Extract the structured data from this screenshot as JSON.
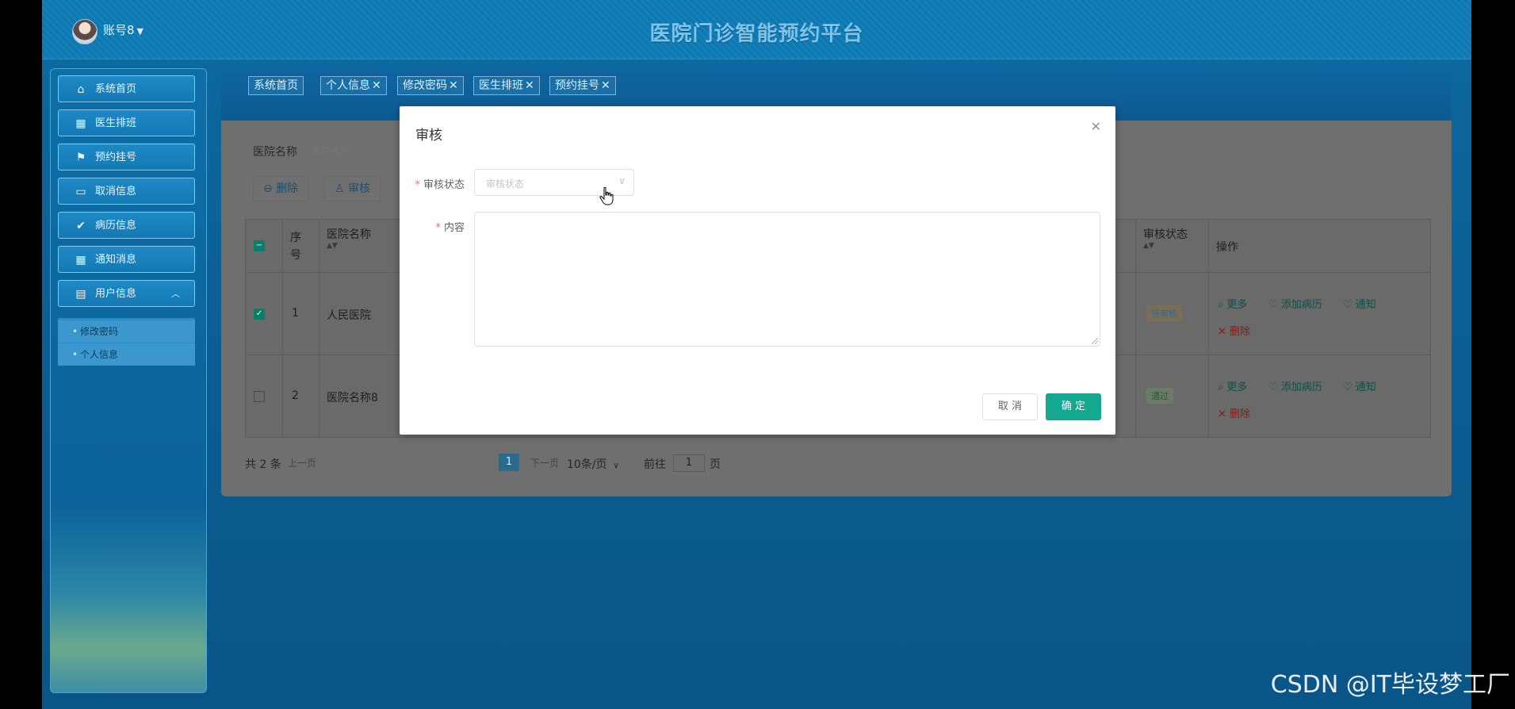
{
  "header": {
    "account": "账号8",
    "app_title": "医院门诊智能预约平台"
  },
  "sidebar": {
    "items": [
      {
        "label": "系统首页",
        "icon": "home-icon"
      },
      {
        "label": "医生排班",
        "icon": "grid-icon"
      },
      {
        "label": "预约挂号",
        "icon": "flag-icon"
      },
      {
        "label": "取消信息",
        "icon": "monitor-icon"
      },
      {
        "label": "病历信息",
        "icon": "clipboard-icon"
      },
      {
        "label": "通知消息",
        "icon": "grid-icon"
      },
      {
        "label": "用户信息",
        "icon": "card-icon",
        "expanded": true
      }
    ],
    "submenu": [
      "修改密码",
      "个人信息"
    ]
  },
  "tabs": [
    {
      "label": "系统首页",
      "closable": false
    },
    {
      "label": "个人信息",
      "closable": true
    },
    {
      "label": "修改密码",
      "closable": true
    },
    {
      "label": "医生排班",
      "closable": true
    },
    {
      "label": "预约挂号",
      "closable": true
    }
  ],
  "search": {
    "label": "医院名称",
    "placeholder": "医院名称"
  },
  "actions": {
    "delete_label": "删除",
    "audit_label": "审核"
  },
  "table": {
    "headers": {
      "index": "序号",
      "hospital": "医院名称",
      "audit_status": "审核状态",
      "operation": "操作"
    },
    "rows": [
      {
        "checked": true,
        "index": "1",
        "hospital": "人民医院",
        "status": "待审核"
      },
      {
        "checked": false,
        "index": "2",
        "hospital": "医院名称8",
        "status": "通过"
      }
    ],
    "row_actions": {
      "more": "更多",
      "add_record": "添加病历",
      "notify": "通知",
      "delete": "删除"
    }
  },
  "pagination": {
    "total": "共 2 条",
    "prev": "上一页",
    "current_page": "1",
    "next": "下一页",
    "page_size": "10条/页",
    "goto_label": "前往",
    "goto_value": "1",
    "page_suffix": "页"
  },
  "dialog": {
    "title": "审核",
    "status_label": "审核状态",
    "status_placeholder": "审核状态",
    "content_label": "内容",
    "content_value": "",
    "cancel_label": "取 消",
    "confirm_label": "确 定"
  },
  "watermark": "CSDN @IT毕设梦工厂",
  "colors": {
    "primary": "#13a88f",
    "header_bg": "#0f77b0",
    "title": "#7ec3ea",
    "required": "#f56c6c"
  }
}
